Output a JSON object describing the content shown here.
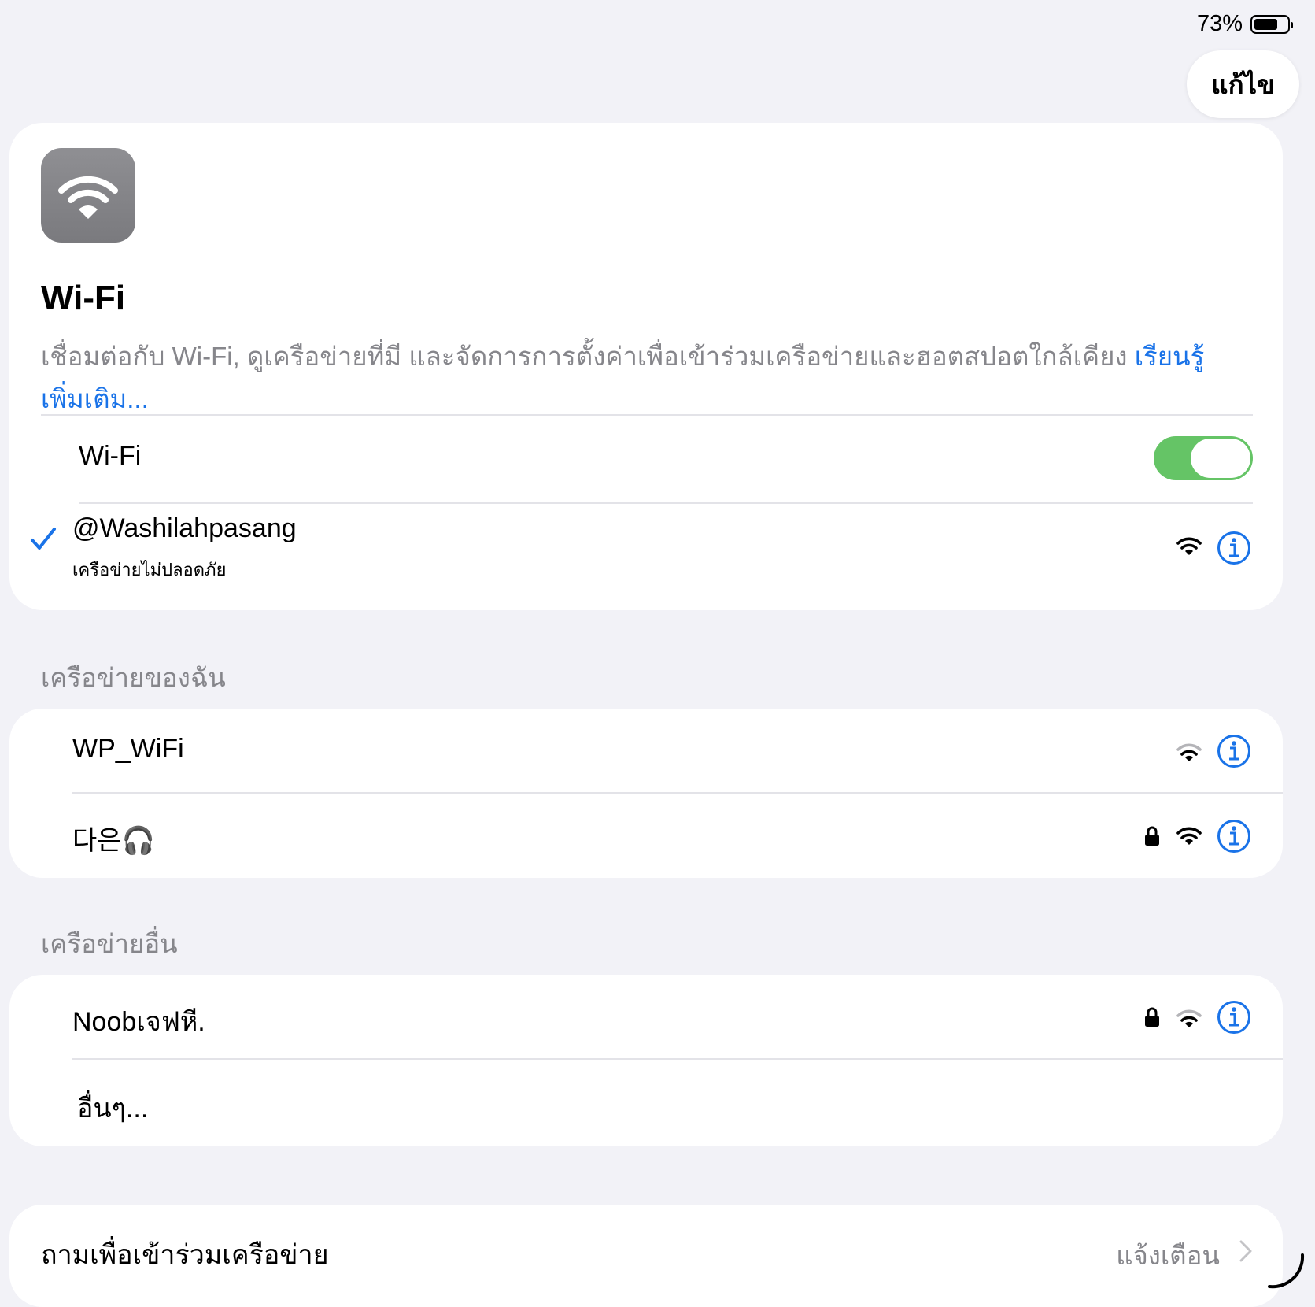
{
  "status": {
    "battery_percent": "73%",
    "battery_level": 0.73
  },
  "header": {
    "edit_label": "แก้ไข"
  },
  "main": {
    "icon": "wifi-icon",
    "title": "Wi-Fi",
    "description": "เชื่อมต่อกับ Wi-Fi, ดูเครือข่ายที่มี และจัดการการตั้งค่าเพื่อเข้าร่วมเครือข่ายและฮอตสปอตใกล้เคียง",
    "learn_more": "เรียนรู้เพิ่มเติม..."
  },
  "wifi_toggle": {
    "label": "Wi-Fi",
    "on": true,
    "color": "#65c466"
  },
  "connected": {
    "name": "@Washilahpasang",
    "subtitle": "เครือข่ายไม่ปลอดภัย",
    "icons": [
      "checkmark-icon",
      "wifi-icon",
      "info-icon"
    ]
  },
  "my_networks": {
    "header": "เครือข่ายของฉัน",
    "items": [
      {
        "name": "WP_WiFi",
        "locked": false,
        "icons": [
          "wifi-icon",
          "info-icon"
        ]
      },
      {
        "name": "다은🎧",
        "locked": true,
        "icons": [
          "lock-icon",
          "wifi-icon",
          "info-icon"
        ]
      }
    ]
  },
  "other_networks": {
    "header": "เครือข่ายอื่น",
    "items": [
      {
        "name": "Noobเจฟหี.",
        "locked": true,
        "icons": [
          "lock-icon",
          "wifi-icon",
          "info-icon"
        ]
      },
      {
        "name": "อื่นๆ..."
      }
    ]
  },
  "ask_to_join": {
    "label": "ถามเพื่อเข้าร่วมเครือข่าย",
    "value": "แจ้งเตือน",
    "icon": "chevron-right-icon"
  },
  "colors": {
    "accent": "#1a73e8",
    "toggle_on": "#65c466",
    "background": "#f2f2f7",
    "secondary_text": "#86868b"
  }
}
